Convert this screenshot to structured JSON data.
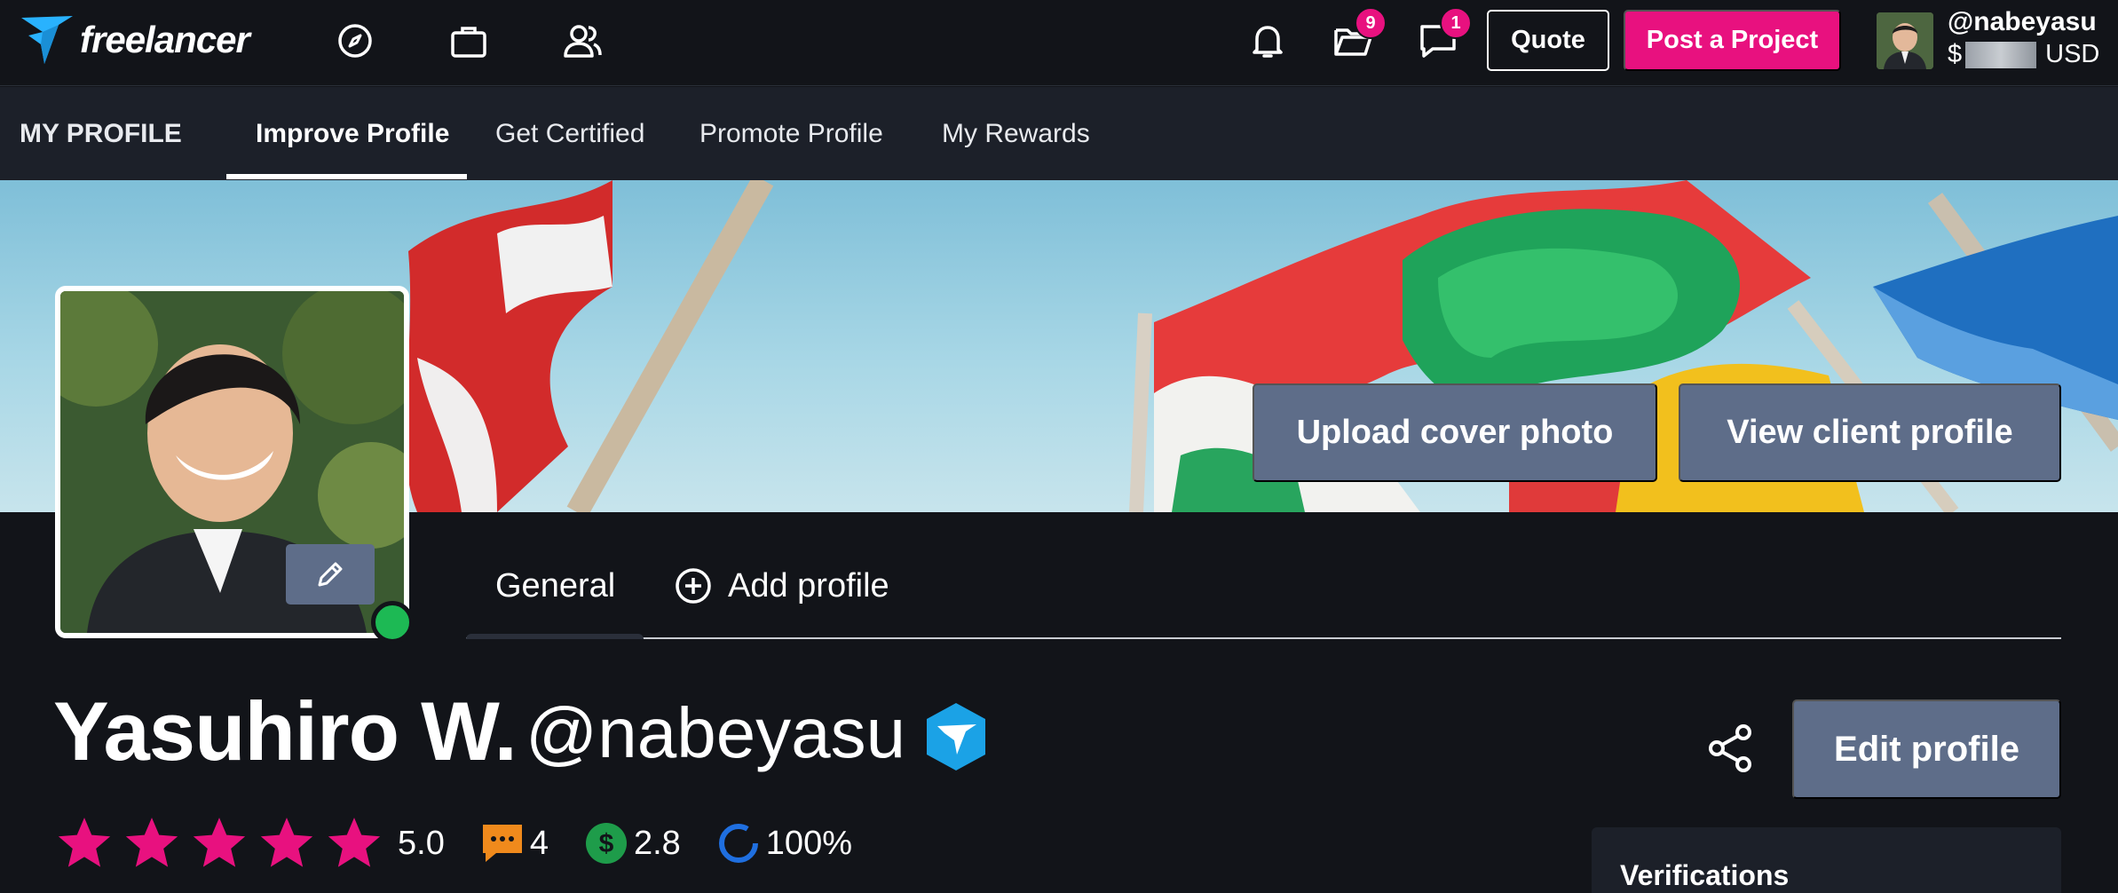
{
  "topbar": {
    "logo_text": "freelancer",
    "icons": [
      "compass-icon",
      "briefcase-icon",
      "people-icon",
      "bell-icon",
      "folder-icon",
      "chat-icon"
    ],
    "projects_badge": "9",
    "messages_badge": "1",
    "quote_label": "Quote",
    "post_project_label": "Post a Project",
    "username": "@nabeyasu",
    "balance_prefix": "$",
    "balance_currency": "USD",
    "accent_color": "#e8117f"
  },
  "subnav": {
    "section_title": "MY PROFILE",
    "items": [
      {
        "label": "Improve Profile",
        "active": true
      },
      {
        "label": "Get Certified"
      },
      {
        "label": "Promote Profile"
      },
      {
        "label": "My Rewards"
      }
    ]
  },
  "cover": {
    "upload_label": "Upload cover photo",
    "view_client_label": "View client profile"
  },
  "profile_tabs": {
    "general": "General",
    "add_profile": "Add profile"
  },
  "profile": {
    "name": "Yasuhiro W.",
    "handle": "@nabeyasu",
    "edit_label": "Edit profile",
    "rating": "5.0",
    "stars": 5,
    "reviews": "4",
    "earnings_score": "2.8",
    "completion": "100%"
  },
  "verifications": {
    "title": "Verifications"
  }
}
